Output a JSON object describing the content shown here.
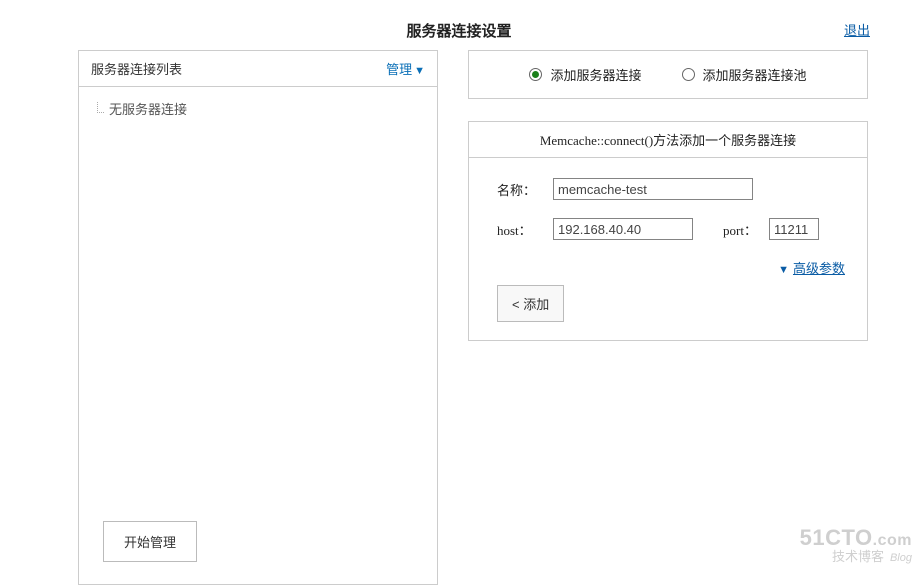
{
  "header": {
    "title": "服务器连接设置",
    "logout": "退出"
  },
  "left": {
    "list_title": "服务器连接列表",
    "manage_label": "管理",
    "empty_item": "无服务器连接",
    "start_manage": "开始管理"
  },
  "right": {
    "radio": {
      "add_server": "添加服务器连接",
      "add_server_selected": true,
      "add_pool": "添加服务器连接池",
      "add_pool_selected": false
    },
    "form": {
      "title_method": "Memcache::connect()",
      "title_suffix": "方法添加一个服务器连接",
      "name_label": "名称：",
      "name_value": "memcache-test",
      "host_label": "host：",
      "host_value": "192.168.40.40",
      "port_label": "port：",
      "port_value": "11211",
      "advanced_label": "高级参数",
      "add_button": "< 添加"
    }
  },
  "watermark": {
    "line1a": "51CTO",
    "line1b": ".com",
    "line2a": "技术博客",
    "line2b": "Blog"
  }
}
